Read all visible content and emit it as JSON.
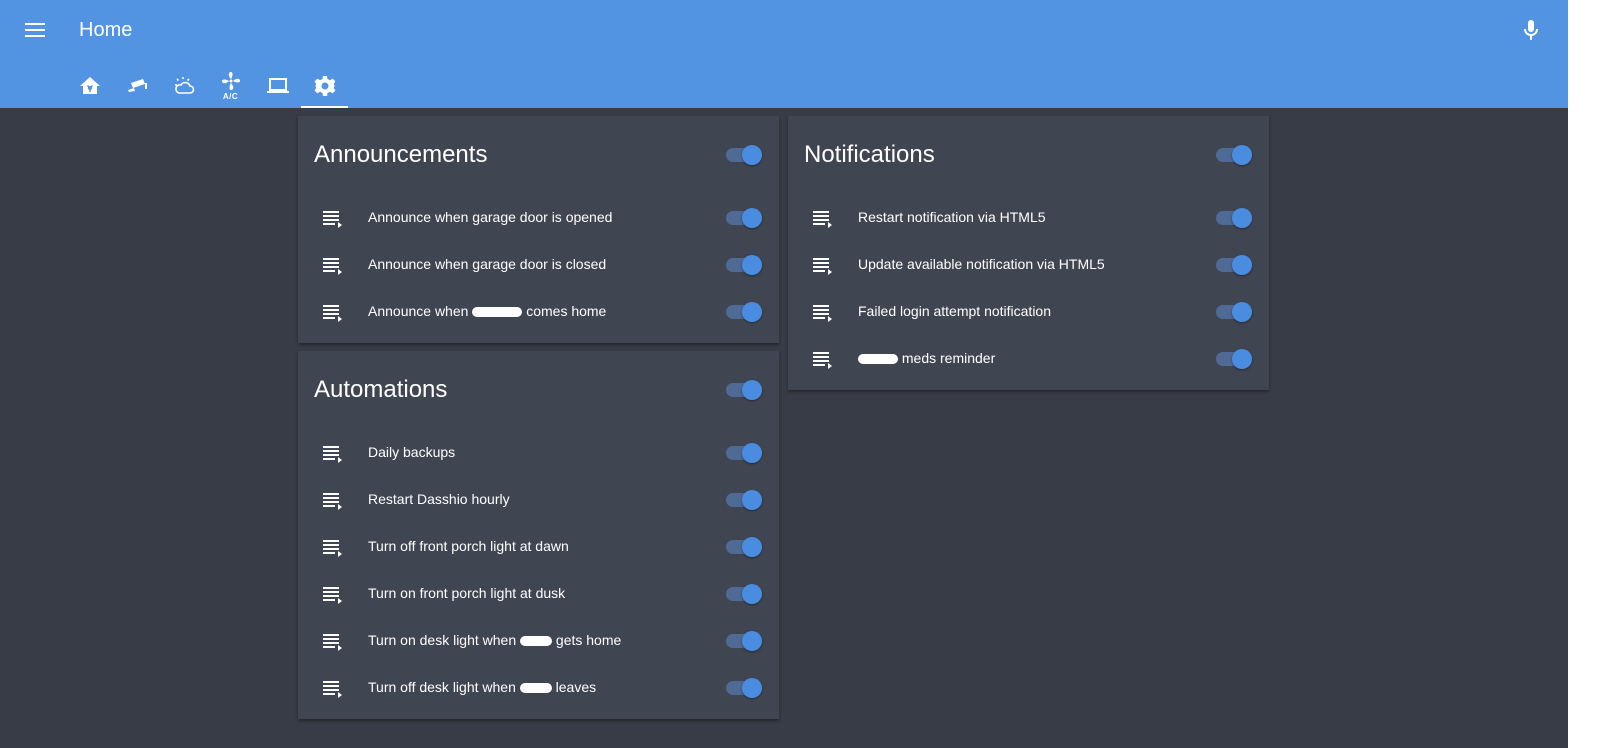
{
  "header": {
    "title": "Home"
  },
  "tabs": [
    {
      "icon": "home-automation-icon"
    },
    {
      "icon": "cctv-icon"
    },
    {
      "icon": "weather-partly-cloudy-icon"
    },
    {
      "icon": "air-conditioner-icon",
      "label": "A/C"
    },
    {
      "icon": "laptop-icon"
    },
    {
      "icon": "settings-icon",
      "active": true
    }
  ],
  "cards": {
    "announcements": {
      "title": "Announcements",
      "toggle_on": true,
      "rows": [
        {
          "label": "Announce when garage door is opened",
          "on": true
        },
        {
          "label": "Announce when garage door is closed",
          "on": true
        },
        {
          "label_before": "Announce when",
          "label_after": "comes home",
          "on": true
        }
      ]
    },
    "automations": {
      "title": "Automations",
      "toggle_on": true,
      "rows": [
        {
          "label": "Daily backups",
          "on": true
        },
        {
          "label": "Restart Dasshio hourly",
          "on": true
        },
        {
          "label": "Turn off front porch light at dawn",
          "on": true
        },
        {
          "label": "Turn on front porch light at dusk",
          "on": true
        },
        {
          "label_before": "Turn on desk light when",
          "label_after": "gets home",
          "on": true
        },
        {
          "label_before": "Turn off desk light when",
          "label_after": "leaves",
          "on": true
        }
      ]
    },
    "notifications": {
      "title": "Notifications",
      "toggle_on": true,
      "rows": [
        {
          "label": "Restart notification via HTML5",
          "on": true
        },
        {
          "label": "Update available notification via HTML5",
          "on": true
        },
        {
          "label": "Failed login attempt notification",
          "on": true
        },
        {
          "label_before": "",
          "label_after": "meds reminder",
          "on": true
        }
      ]
    }
  },
  "colors": {
    "header": "#5294e2",
    "background": "#383c46",
    "card": "#404552",
    "toggle_knob": "#4a8de0",
    "toggle_track": "#4e6a95"
  }
}
